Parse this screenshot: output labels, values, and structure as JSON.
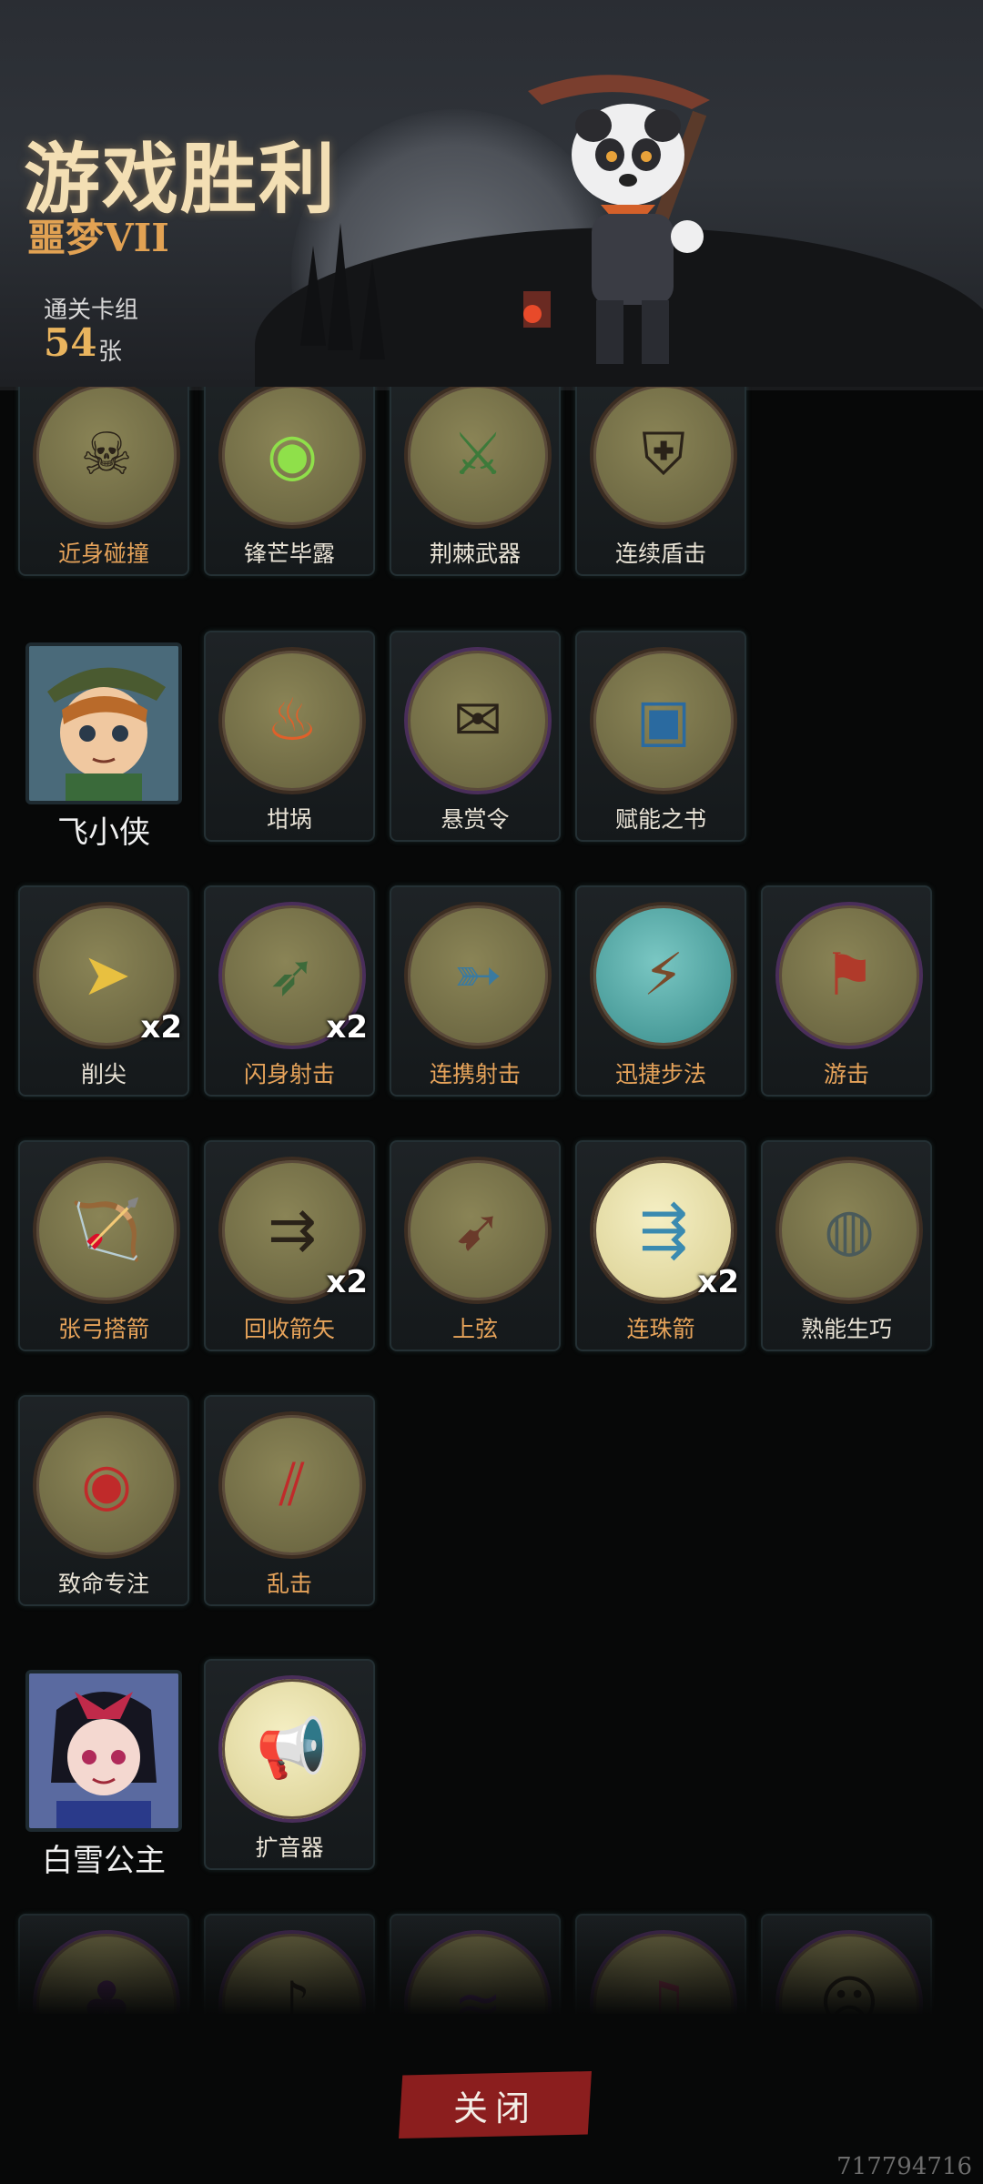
{
  "header": {
    "title": "游戏胜利",
    "difficulty": "噩梦VII",
    "deck_label": "通关卡组",
    "deck_count": "54",
    "deck_unit": "张"
  },
  "groups": [
    {
      "hero": null,
      "cards": [
        {
          "name": "近身碰撞",
          "color": "orange",
          "icon": "skeleton-shield-icon"
        },
        {
          "name": "锋芒毕露",
          "color": "white",
          "icon": "spiked-shield-icon"
        },
        {
          "name": "荆棘武器",
          "color": "white",
          "icon": "thorn-archer-icon"
        },
        {
          "name": "连续盾击",
          "color": "white",
          "icon": "shield-bash-icon"
        }
      ]
    },
    {
      "hero": {
        "name": "飞小侠",
        "icon": "hero-flying-boy-portrait"
      },
      "cards": [
        {
          "name": "坩埚",
          "color": "white",
          "icon": "cauldron-icon"
        },
        {
          "name": "悬赏令",
          "color": "white",
          "icon": "wanted-poster-icon"
        },
        {
          "name": "赋能之书",
          "color": "white",
          "icon": "spell-book-icon"
        }
      ]
    },
    {
      "hero": null,
      "cards": [
        {
          "name": "削尖",
          "color": "white",
          "icon": "sharpen-arrowhead-icon",
          "badge": "x2"
        },
        {
          "name": "闪身射击",
          "color": "orange",
          "icon": "dodge-shot-icon",
          "badge": "x2"
        },
        {
          "name": "连携射击",
          "color": "orange",
          "icon": "combo-shot-icon"
        },
        {
          "name": "迅捷步法",
          "color": "orange",
          "icon": "swift-boot-icon"
        },
        {
          "name": "游击",
          "color": "orange",
          "icon": "map-flags-icon"
        }
      ]
    },
    {
      "hero": null,
      "cards": [
        {
          "name": "张弓搭箭",
          "color": "orange",
          "icon": "drawing-bow-icon"
        },
        {
          "name": "回收箭矢",
          "color": "orange",
          "icon": "arrows-icon",
          "badge": "x2"
        },
        {
          "name": "上弦",
          "color": "orange",
          "icon": "crossed-bow-arrow-icon"
        },
        {
          "name": "连珠箭",
          "color": "orange",
          "icon": "volley-arrows-icon",
          "badge": "x2"
        },
        {
          "name": "熟能生巧",
          "color": "white",
          "icon": "boulder-target-icon"
        }
      ]
    },
    {
      "hero": null,
      "cards": [
        {
          "name": "致命专注",
          "color": "white",
          "icon": "eye-focus-icon"
        },
        {
          "name": "乱击",
          "color": "orange",
          "icon": "claw-slash-icon"
        }
      ]
    },
    {
      "hero": {
        "name": "白雪公主",
        "icon": "hero-snow-white-portrait"
      },
      "cards": [
        {
          "name": "扩音器",
          "color": "white",
          "icon": "megaphone-icon"
        }
      ]
    }
  ],
  "partial_row_icons": [
    "hooded-witch-icon",
    "dancing-man-icon",
    "purple-tentacle-icon",
    "singer-icon",
    "screaming-scientist-icon"
  ],
  "buttons": {
    "close": "关闭"
  },
  "watermark": "717794716"
}
